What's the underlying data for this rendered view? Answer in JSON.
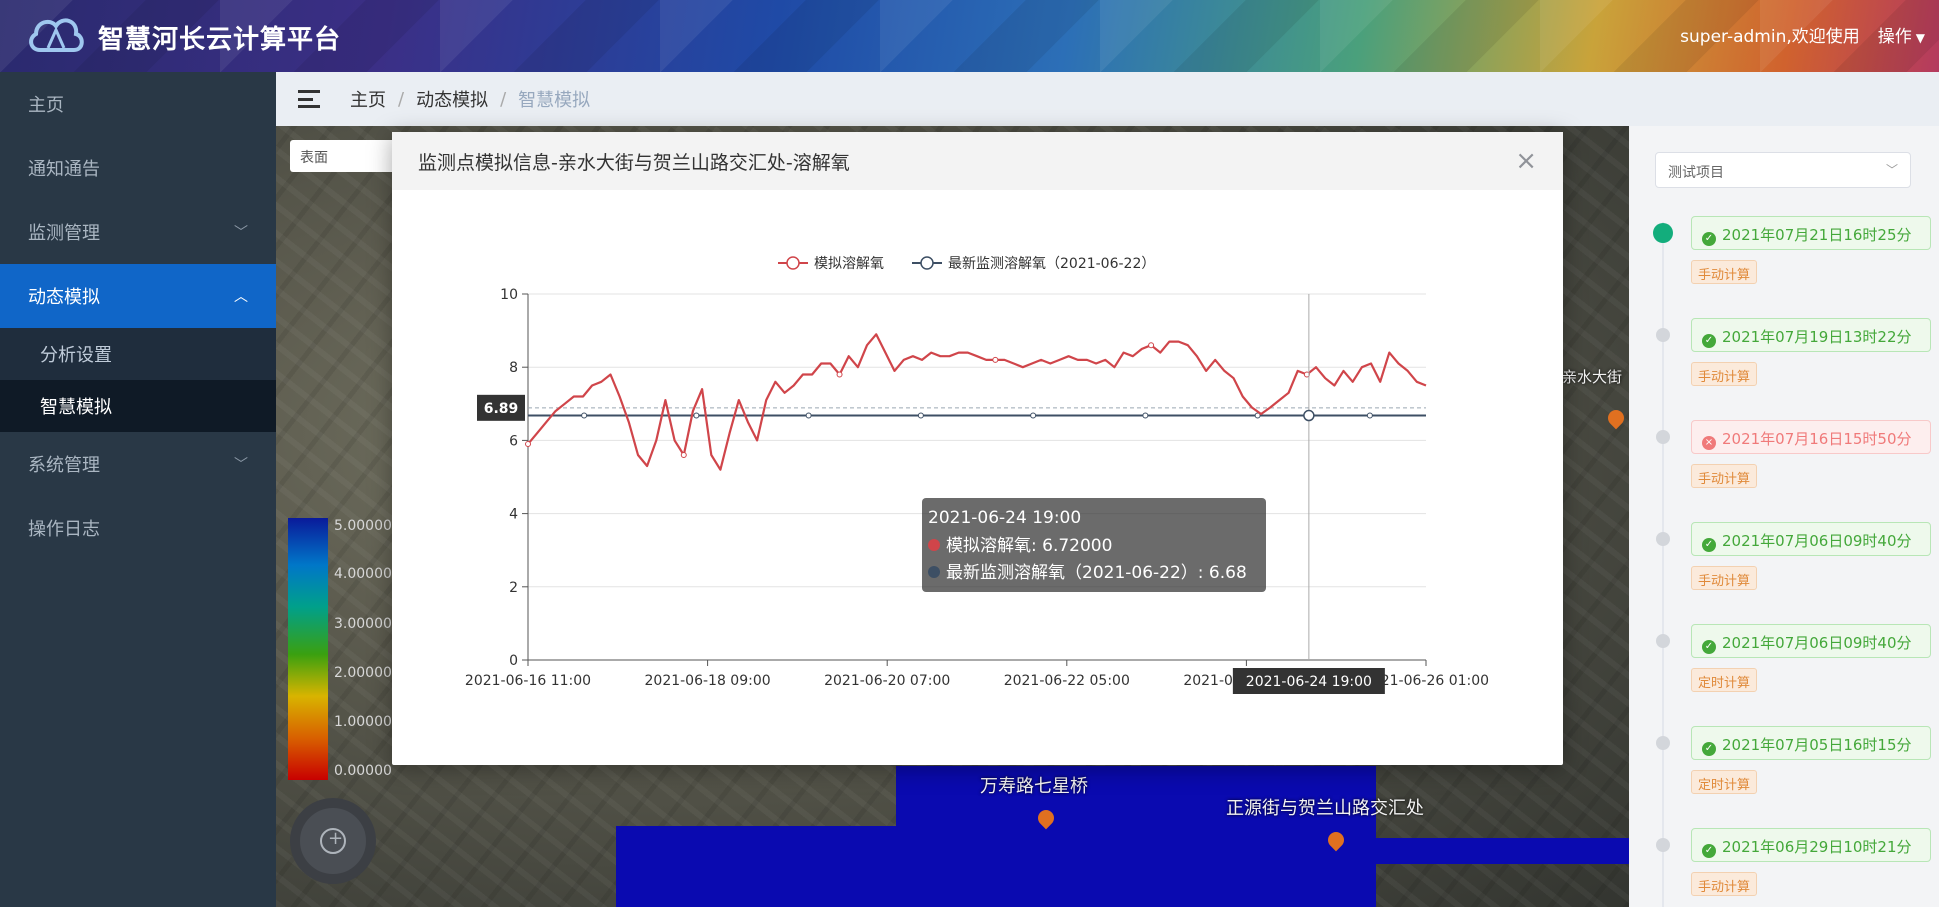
{
  "header": {
    "title": "智慧河长云计算平台",
    "user_greeting": "super-admin,欢迎使用",
    "ops_label": "操作"
  },
  "sidebar": {
    "items": [
      {
        "label": "主页"
      },
      {
        "label": "通知通告"
      },
      {
        "label": "监测管理"
      },
      {
        "label": "动态模拟",
        "subitems": [
          {
            "label": "分析设置"
          },
          {
            "label": "智慧模拟"
          }
        ]
      },
      {
        "label": "系统管理"
      },
      {
        "label": "操作日志"
      }
    ]
  },
  "breadcrumb": {
    "home": "主页",
    "section": "动态模拟",
    "current": "智慧模拟"
  },
  "map": {
    "layer_select": "表面",
    "legend_labels": [
      "5.00000",
      "4.00000",
      "3.00000",
      "2.00000",
      "1.00000",
      "0.00000"
    ],
    "labels": [
      "万寿路七星桥",
      "正源街与贺兰山路交汇处",
      "亲水大街"
    ]
  },
  "right_panel": {
    "project_select": "测试项目",
    "timeline": [
      {
        "time": "2021年07月21日16时25分",
        "type": "手动计算",
        "status": "success"
      },
      {
        "time": "2021年07月19日13时22分",
        "type": "手动计算",
        "status": "success"
      },
      {
        "time": "2021年07月16日15时50分",
        "type": "手动计算",
        "status": "fail"
      },
      {
        "time": "2021年07月06日09时40分",
        "type": "手动计算",
        "status": "success"
      },
      {
        "time": "2021年07月06日09时40分",
        "type": "定时计算",
        "status": "success"
      },
      {
        "time": "2021年07月05日16时15分",
        "type": "定时计算",
        "status": "success"
      },
      {
        "time": "2021年06月29日10时21分",
        "type": "手动计算",
        "status": "success"
      }
    ]
  },
  "modal": {
    "title": "监测点模拟信息-亲水大街与贺兰山路交汇处-溶解氧",
    "close": "×"
  },
  "colors": {
    "sim": "#d0454a",
    "obs": "#3d4f64",
    "accent": "#1066c8"
  },
  "chart_data": {
    "type": "line",
    "ylim": [
      0,
      10
    ],
    "y_ticks": [
      0,
      2,
      4,
      6,
      8,
      10
    ],
    "x_ticks": [
      "2021-06-16 11:00",
      "2021-06-18 09:00",
      "2021-06-20 07:00",
      "2021-06-22 05:00",
      "2021-06-24 03:00",
      "2021-06-26 01:00"
    ],
    "x_start": "2021-06-16 11:00",
    "x_end": "2021-06-26 01:00",
    "series": [
      {
        "name": "模拟溶解氧",
        "color": "#d0454a",
        "values": [
          5.9,
          6.2,
          6.5,
          6.8,
          7.0,
          7.2,
          7.2,
          7.5,
          7.6,
          7.8,
          7.2,
          6.5,
          5.6,
          5.3,
          6.0,
          7.1,
          6.0,
          5.6,
          6.8,
          7.4,
          5.6,
          5.2,
          6.2,
          7.1,
          6.5,
          6.0,
          7.1,
          7.6,
          7.3,
          7.5,
          7.8,
          7.8,
          8.1,
          8.1,
          7.8,
          8.3,
          8.0,
          8.6,
          8.9,
          8.4,
          7.9,
          8.2,
          8.3,
          8.2,
          8.4,
          8.3,
          8.3,
          8.4,
          8.4,
          8.3,
          8.2,
          8.2,
          8.2,
          8.1,
          8.0,
          8.1,
          8.2,
          8.1,
          8.2,
          8.3,
          8.2,
          8.2,
          8.1,
          8.2,
          8.0,
          8.4,
          8.3,
          8.5,
          8.6,
          8.4,
          8.7,
          8.7,
          8.6,
          8.3,
          7.9,
          8.2,
          7.9,
          7.7,
          7.2,
          6.9,
          6.72,
          6.9,
          7.1,
          7.3,
          7.9,
          7.8,
          8.0,
          7.7,
          7.5,
          7.9,
          7.6,
          8.0,
          8.1,
          7.6,
          8.4,
          8.1,
          7.9,
          7.6,
          7.5
        ]
      },
      {
        "name": "最新监测溶解氧（2021-06-22）",
        "color": "#3d4f64",
        "value": 6.68
      }
    ],
    "markline_label": "6.89",
    "tooltip": {
      "time": "2021-06-24 19:00",
      "sim_text": "模拟溶解氧: 6.72000",
      "obs_text": "最新监测溶解氧（2021-06-22）: 6.68",
      "axis_pointer": "2021-06-24 19:00",
      "x": "2021-06-24 19:00"
    }
  }
}
